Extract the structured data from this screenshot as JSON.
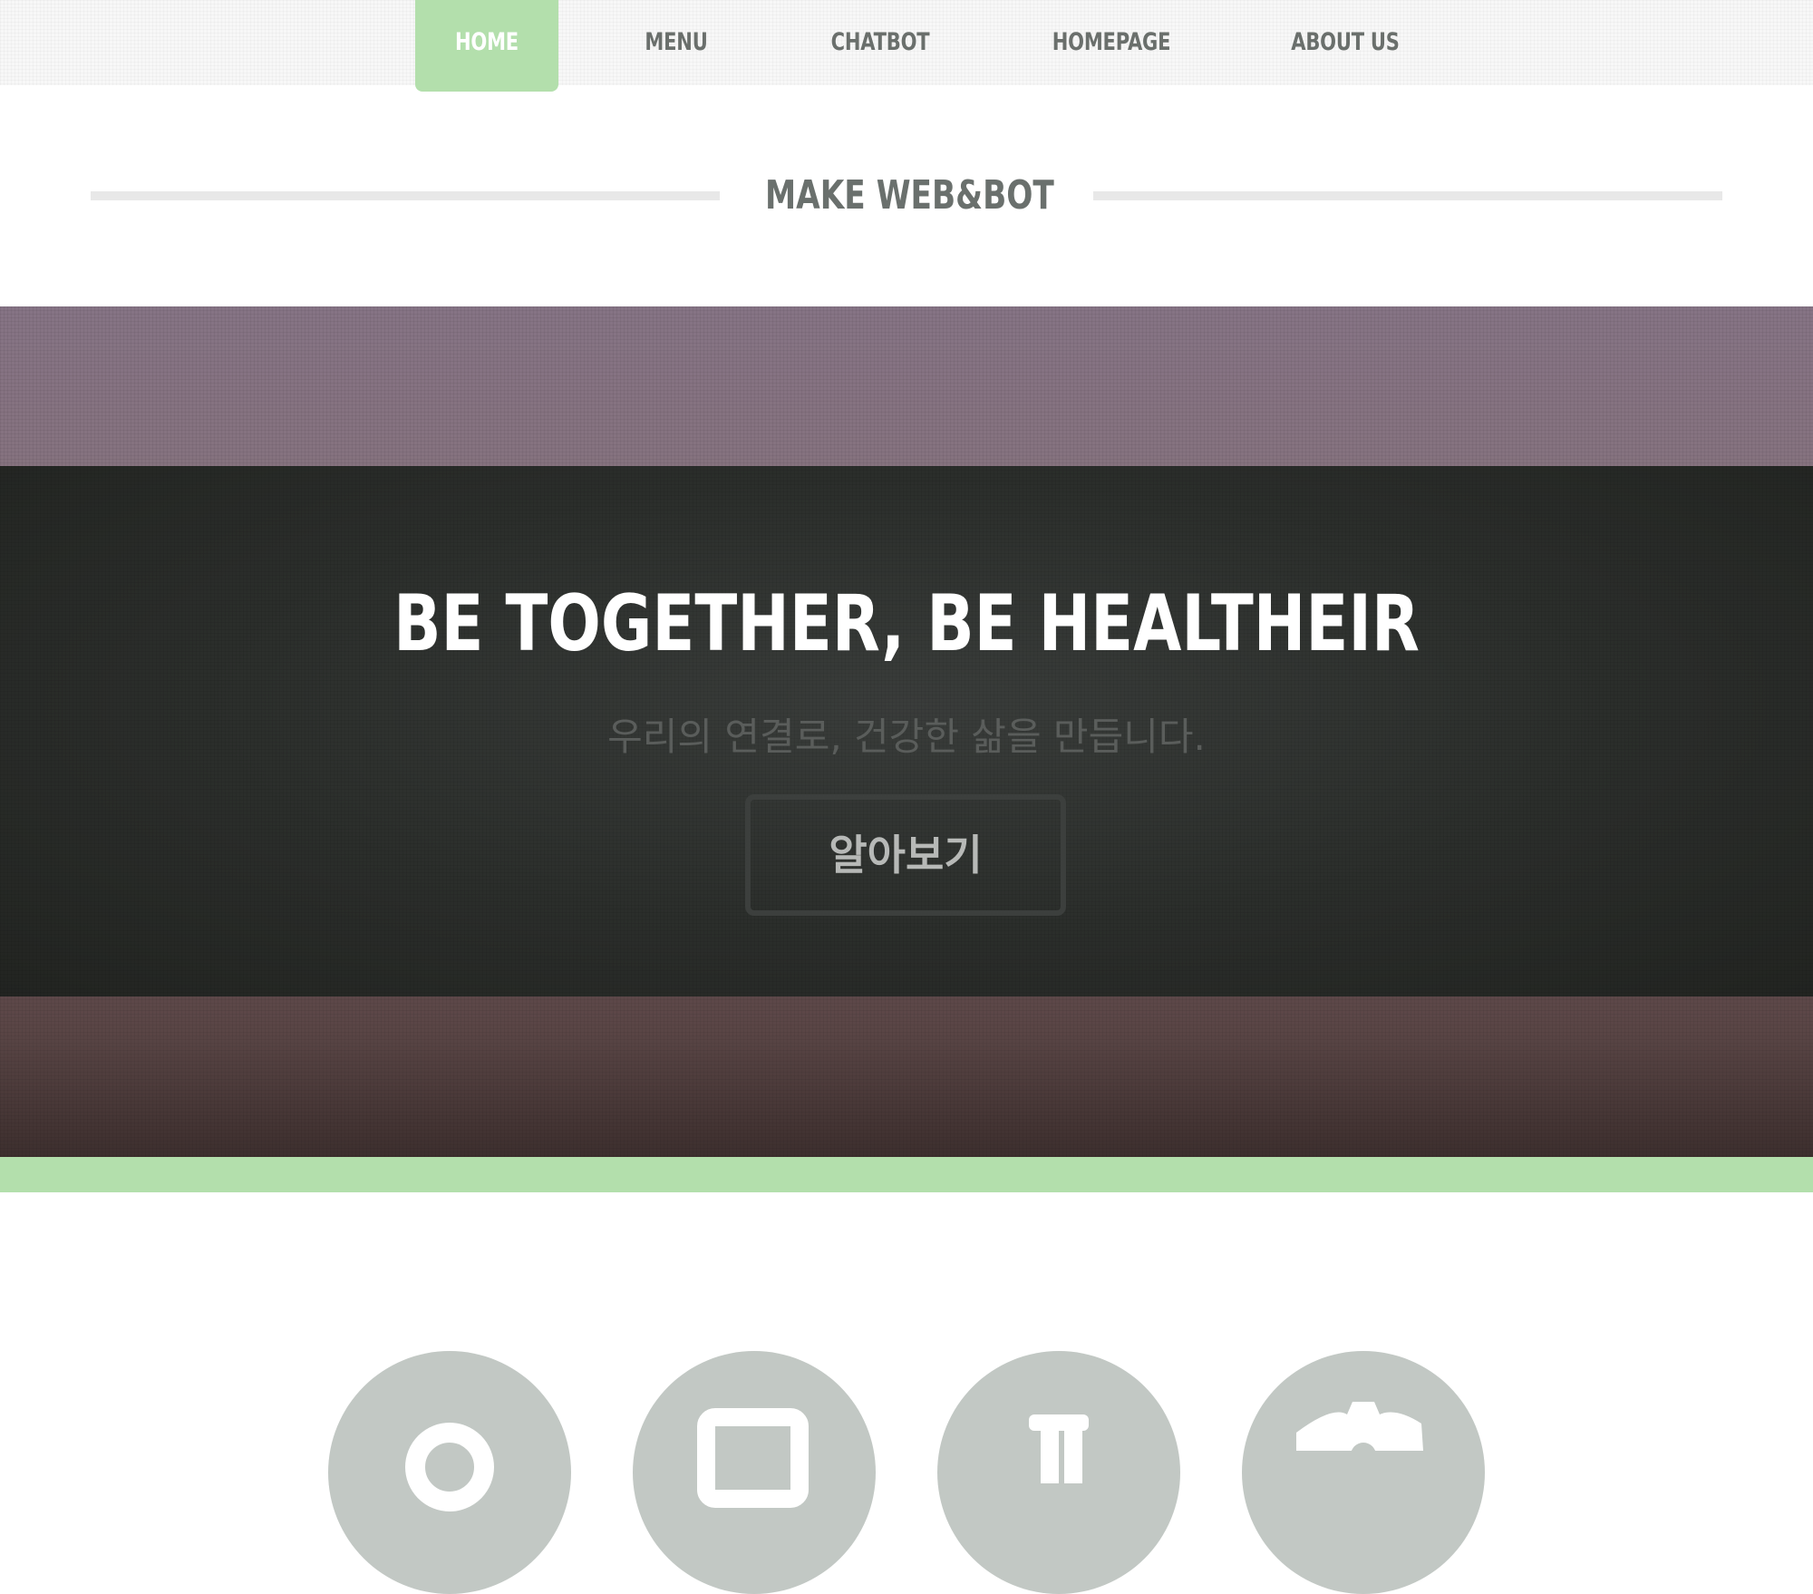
{
  "nav": {
    "items": [
      {
        "label": "HOME",
        "active": true
      },
      {
        "label": "MENU"
      },
      {
        "label": "CHATBOT"
      },
      {
        "label": "HOMEPAGE"
      },
      {
        "label": "ABOUT US"
      }
    ],
    "active_color": "#b3dfac"
  },
  "section": {
    "title": "MAKE WEB&BOT"
  },
  "hero": {
    "title": "BE TOGETHER, BE HEALTHEIR",
    "subtitle": "우리의 연결로, 건강한 삶을 만듭니다.",
    "button_label": "알아보기"
  },
  "features": {
    "icons": [
      "location-pin-icon",
      "monitor-icon",
      "flask-icon",
      "gear-icon"
    ],
    "circle_color": "#c2c8c4"
  },
  "colors": {
    "accent": "#b3dfac",
    "text_dark": "#6a6f6c"
  }
}
